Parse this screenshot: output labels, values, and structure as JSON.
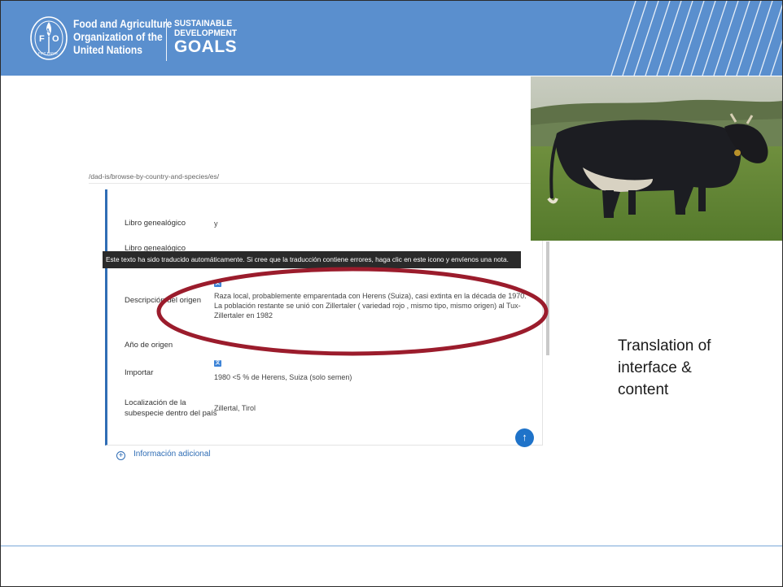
{
  "header": {
    "org_lines": [
      "Food and Agriculture",
      "Organization of the",
      "United Nations"
    ],
    "sdg_lines": [
      "SUSTAINABLE",
      "DEVELOPMENT",
      "GOALS"
    ],
    "logo_text": [
      "F",
      "A",
      "O",
      "FIAT PANIS"
    ],
    "colors": {
      "banner": "#5a8fce"
    }
  },
  "screenshot": {
    "url": "/dad-is/browse-by-country-and-species/es/",
    "rows": [
      {
        "label": "Libro genealógico",
        "value": "y"
      },
      {
        "label": "Libro genealógico",
        "value": ""
      },
      {
        "label": "Descripción del origen",
        "value": "Raza local, probablemente emparentada con Herens (Suiza), casi extinta en la década de 1970. La población restante se unió con Zillertaler ( variedad rojo , mismo tipo, mismo origen) al Tux-Zillertaler en 1982"
      },
      {
        "label": "Año de origen",
        "value": ""
      },
      {
        "label": "Importar",
        "value": "1980 <5 % de Herens, Suiza (solo semen)"
      },
      {
        "label_lines": [
          "Localización de la",
          "subespecie dentro del país"
        ],
        "value": "Zillertal, Tirol"
      }
    ],
    "tooltip": "Este texto ha sido traducido automáticamente. Si cree que la traducción contiene errores, haga clic en este icono y envíenos una nota.",
    "additional_info": "Información adicional",
    "icons": {
      "translate": "translate-icon",
      "scroll_top": "arrow-up-icon",
      "expand": "plus-circle-icon"
    }
  },
  "caption_lines": [
    "Translation of",
    "interface &",
    "content"
  ],
  "annotation": {
    "color": "#9b1c2c",
    "shape": "ellipse"
  },
  "photo": {
    "subject": "cow-photo"
  }
}
